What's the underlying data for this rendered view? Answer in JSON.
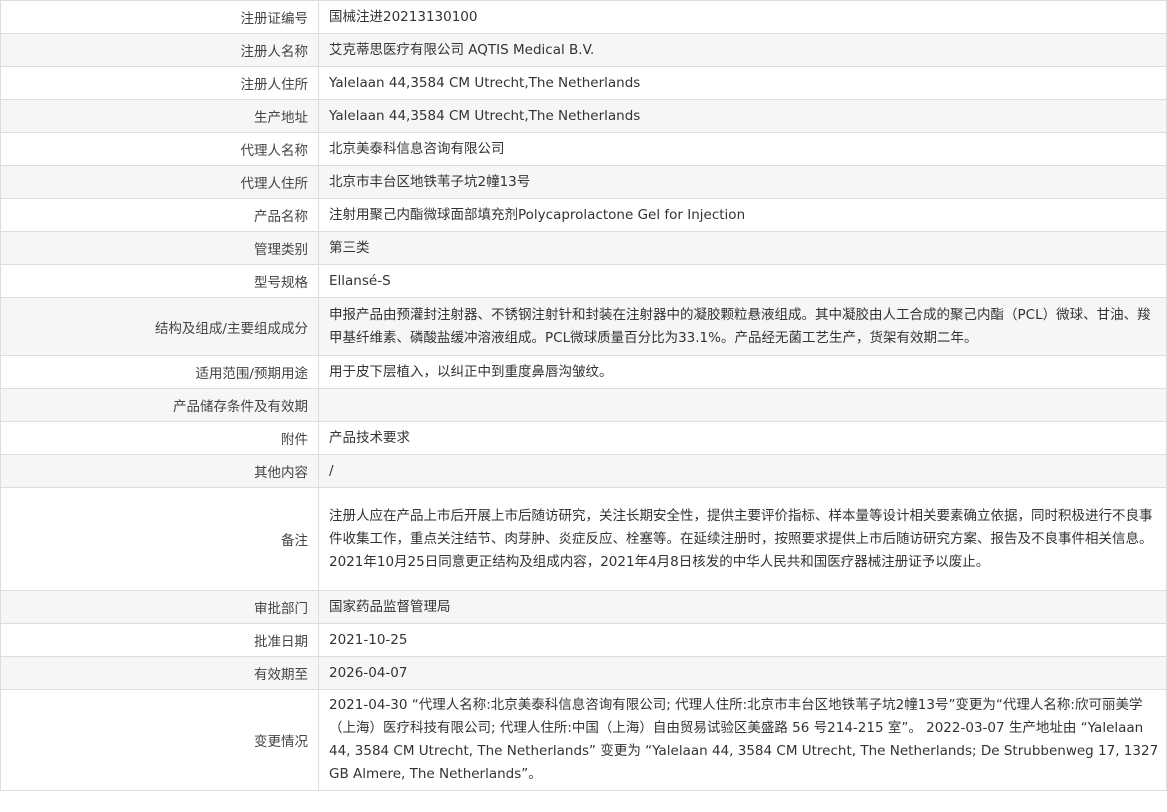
{
  "rows": [
    {
      "label": "注册证编号",
      "value": "国械注进20213130100"
    },
    {
      "label": "注册人名称",
      "value": "艾克蒂思医疗有限公司 AQTIS Medical B.V."
    },
    {
      "label": "注册人住所",
      "value": "Yalelaan 44,3584 CM Utrecht,The Netherlands"
    },
    {
      "label": "生产地址",
      "value": "Yalelaan 44,3584 CM Utrecht,The Netherlands"
    },
    {
      "label": "代理人名称",
      "value": "北京美泰科信息咨询有限公司"
    },
    {
      "label": "代理人住所",
      "value": "北京市丰台区地铁苇子坑2幢13号"
    },
    {
      "label": "产品名称",
      "value": "注射用聚己内酯微球面部填充剂Polycaprolactone Gel for Injection"
    },
    {
      "label": "管理类别",
      "value": "第三类"
    },
    {
      "label": "型号规格",
      "value": "Ellansé-S"
    },
    {
      "label": "结构及组成/主要组成成分",
      "value": "申报产品由预灌封注射器、不锈钢注射针和封装在注射器中的凝胶颗粒悬液组成。其中凝胶由人工合成的聚己内酯（PCL）微球、甘油、羧甲基纤维素、磷酸盐缓冲溶液组成。PCL微球质量百分比为33.1%。产品经无菌工艺生产，货架有效期二年。"
    },
    {
      "label": "适用范围/预期用途",
      "value": "用于皮下层植入，以纠正中到重度鼻唇沟皱纹。"
    },
    {
      "label": "产品储存条件及有效期",
      "value": ""
    },
    {
      "label": "附件",
      "value": "产品技术要求"
    },
    {
      "label": "其他内容",
      "value": "/"
    },
    {
      "label": "备注",
      "value_lines": [
        "注册人应在产品上市后开展上市后随访研究，关注长期安全性，提供主要评价指标、样本量等设计相关要素确立依据，同时积极进行不良事件收集工作，重点关注结节、肉芽肿、炎症反应、栓塞等。在延续注册时，按照要求提供上市后随访研究方案、报告及不良事件相关信息。",
        "2021年10月25日同意更正结构及组成内容，2021年4月8日核发的中华人民共和国医疗器械注册证予以废止。"
      ]
    },
    {
      "label": "审批部门",
      "value": "国家药品监督管理局"
    },
    {
      "label": "批准日期",
      "value": "2021-10-25"
    },
    {
      "label": "有效期至",
      "value": "2026-04-07"
    },
    {
      "label": "变更情况",
      "value": "2021-04-30 “代理人名称:北京美泰科信息咨询有限公司; 代理人住所:北京市丰台区地铁苇子坑2幢13号”变更为“代理人名称:欣可丽美学（上海）医疗科技有限公司; 代理人住所:中国（上海）自由贸易试验区美盛路 56 号214-215 室”。 2022-03-07 生产地址由 “Yalelaan 44, 3584 CM Utrecht, The Netherlands” 变更为 “Yalelaan 44, 3584 CM Utrecht, The Netherlands; De Strubbenweg 17, 1327 GB Almere, The Netherlands”。"
    }
  ]
}
